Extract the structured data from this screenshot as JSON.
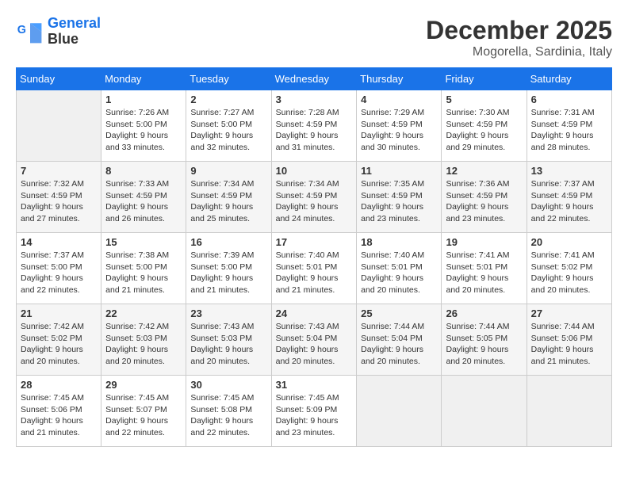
{
  "header": {
    "logo_line1": "General",
    "logo_line2": "Blue",
    "month": "December 2025",
    "location": "Mogorella, Sardinia, Italy"
  },
  "weekdays": [
    "Sunday",
    "Monday",
    "Tuesday",
    "Wednesday",
    "Thursday",
    "Friday",
    "Saturday"
  ],
  "weeks": [
    [
      {
        "day": "",
        "empty": true
      },
      {
        "day": "1",
        "sunrise": "7:26 AM",
        "sunset": "5:00 PM",
        "daylight": "9 hours and 33 minutes."
      },
      {
        "day": "2",
        "sunrise": "7:27 AM",
        "sunset": "5:00 PM",
        "daylight": "9 hours and 32 minutes."
      },
      {
        "day": "3",
        "sunrise": "7:28 AM",
        "sunset": "4:59 PM",
        "daylight": "9 hours and 31 minutes."
      },
      {
        "day": "4",
        "sunrise": "7:29 AM",
        "sunset": "4:59 PM",
        "daylight": "9 hours and 30 minutes."
      },
      {
        "day": "5",
        "sunrise": "7:30 AM",
        "sunset": "4:59 PM",
        "daylight": "9 hours and 29 minutes."
      },
      {
        "day": "6",
        "sunrise": "7:31 AM",
        "sunset": "4:59 PM",
        "daylight": "9 hours and 28 minutes."
      }
    ],
    [
      {
        "day": "7",
        "sunrise": "7:32 AM",
        "sunset": "4:59 PM",
        "daylight": "9 hours and 27 minutes."
      },
      {
        "day": "8",
        "sunrise": "7:33 AM",
        "sunset": "4:59 PM",
        "daylight": "9 hours and 26 minutes."
      },
      {
        "day": "9",
        "sunrise": "7:34 AM",
        "sunset": "4:59 PM",
        "daylight": "9 hours and 25 minutes."
      },
      {
        "day": "10",
        "sunrise": "7:34 AM",
        "sunset": "4:59 PM",
        "daylight": "9 hours and 24 minutes."
      },
      {
        "day": "11",
        "sunrise": "7:35 AM",
        "sunset": "4:59 PM",
        "daylight": "9 hours and 23 minutes."
      },
      {
        "day": "12",
        "sunrise": "7:36 AM",
        "sunset": "4:59 PM",
        "daylight": "9 hours and 23 minutes."
      },
      {
        "day": "13",
        "sunrise": "7:37 AM",
        "sunset": "4:59 PM",
        "daylight": "9 hours and 22 minutes."
      }
    ],
    [
      {
        "day": "14",
        "sunrise": "7:37 AM",
        "sunset": "5:00 PM",
        "daylight": "9 hours and 22 minutes."
      },
      {
        "day": "15",
        "sunrise": "7:38 AM",
        "sunset": "5:00 PM",
        "daylight": "9 hours and 21 minutes."
      },
      {
        "day": "16",
        "sunrise": "7:39 AM",
        "sunset": "5:00 PM",
        "daylight": "9 hours and 21 minutes."
      },
      {
        "day": "17",
        "sunrise": "7:40 AM",
        "sunset": "5:01 PM",
        "daylight": "9 hours and 21 minutes."
      },
      {
        "day": "18",
        "sunrise": "7:40 AM",
        "sunset": "5:01 PM",
        "daylight": "9 hours and 20 minutes."
      },
      {
        "day": "19",
        "sunrise": "7:41 AM",
        "sunset": "5:01 PM",
        "daylight": "9 hours and 20 minutes."
      },
      {
        "day": "20",
        "sunrise": "7:41 AM",
        "sunset": "5:02 PM",
        "daylight": "9 hours and 20 minutes."
      }
    ],
    [
      {
        "day": "21",
        "sunrise": "7:42 AM",
        "sunset": "5:02 PM",
        "daylight": "9 hours and 20 minutes."
      },
      {
        "day": "22",
        "sunrise": "7:42 AM",
        "sunset": "5:03 PM",
        "daylight": "9 hours and 20 minutes."
      },
      {
        "day": "23",
        "sunrise": "7:43 AM",
        "sunset": "5:03 PM",
        "daylight": "9 hours and 20 minutes."
      },
      {
        "day": "24",
        "sunrise": "7:43 AM",
        "sunset": "5:04 PM",
        "daylight": "9 hours and 20 minutes."
      },
      {
        "day": "25",
        "sunrise": "7:44 AM",
        "sunset": "5:04 PM",
        "daylight": "9 hours and 20 minutes."
      },
      {
        "day": "26",
        "sunrise": "7:44 AM",
        "sunset": "5:05 PM",
        "daylight": "9 hours and 20 minutes."
      },
      {
        "day": "27",
        "sunrise": "7:44 AM",
        "sunset": "5:06 PM",
        "daylight": "9 hours and 21 minutes."
      }
    ],
    [
      {
        "day": "28",
        "sunrise": "7:45 AM",
        "sunset": "5:06 PM",
        "daylight": "9 hours and 21 minutes."
      },
      {
        "day": "29",
        "sunrise": "7:45 AM",
        "sunset": "5:07 PM",
        "daylight": "9 hours and 22 minutes."
      },
      {
        "day": "30",
        "sunrise": "7:45 AM",
        "sunset": "5:08 PM",
        "daylight": "9 hours and 22 minutes."
      },
      {
        "day": "31",
        "sunrise": "7:45 AM",
        "sunset": "5:09 PM",
        "daylight": "9 hours and 23 minutes."
      },
      {
        "day": "",
        "empty": true
      },
      {
        "day": "",
        "empty": true
      },
      {
        "day": "",
        "empty": true
      }
    ]
  ]
}
